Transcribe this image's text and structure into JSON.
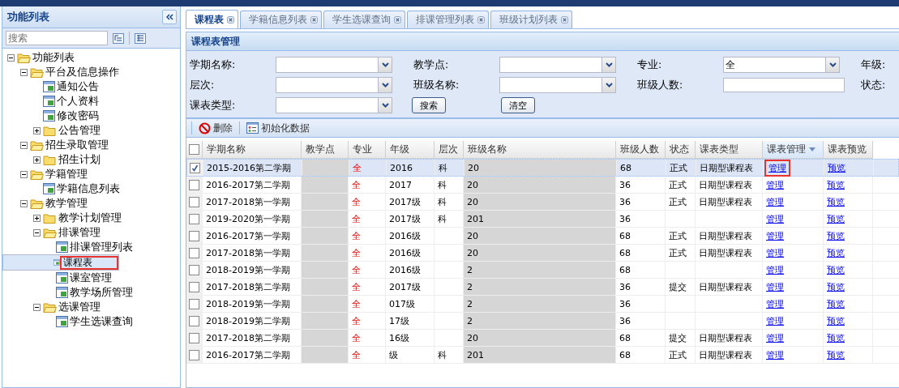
{
  "sidebar": {
    "title": "功能列表",
    "search": {
      "placeholder": "搜索"
    },
    "tree": [
      {
        "label": "功能列表",
        "kind": "folder",
        "expanded": true,
        "selected": false,
        "annotated": false,
        "children": [
          {
            "label": "平台及信息操作",
            "kind": "folder",
            "expanded": true,
            "selected": false,
            "annotated": false,
            "children": [
              {
                "label": "通知公告",
                "kind": "page",
                "selected": false,
                "annotated": false
              },
              {
                "label": "个人资料",
                "kind": "page",
                "selected": false,
                "annotated": false
              },
              {
                "label": "修改密码",
                "kind": "page",
                "selected": false,
                "annotated": false
              },
              {
                "label": "公告管理",
                "kind": "folder",
                "expanded": false,
                "selected": false,
                "annotated": false
              }
            ]
          },
          {
            "label": "招生录取管理",
            "kind": "folder",
            "expanded": true,
            "selected": false,
            "annotated": false,
            "children": [
              {
                "label": "招生计划",
                "kind": "folder",
                "expanded": false,
                "selected": false,
                "annotated": false
              }
            ]
          },
          {
            "label": "学籍管理",
            "kind": "folder",
            "expanded": true,
            "selected": false,
            "annotated": false,
            "children": [
              {
                "label": "学籍信息列表",
                "kind": "page",
                "selected": false,
                "annotated": false
              }
            ]
          },
          {
            "label": "教学管理",
            "kind": "folder",
            "expanded": true,
            "selected": false,
            "annotated": false,
            "children": [
              {
                "label": "教学计划管理",
                "kind": "folder",
                "expanded": false,
                "selected": false,
                "annotated": false
              },
              {
                "label": "排课管理",
                "kind": "folder",
                "expanded": true,
                "selected": false,
                "annotated": false,
                "children": [
                  {
                    "label": "排课管理列表",
                    "kind": "page",
                    "selected": false,
                    "annotated": false
                  },
                  {
                    "label": "课程表",
                    "kind": "page",
                    "selected": true,
                    "annotated": true
                  },
                  {
                    "label": "课室管理",
                    "kind": "page",
                    "selected": false,
                    "annotated": false
                  },
                  {
                    "label": "教学场所管理",
                    "kind": "page",
                    "selected": false,
                    "annotated": false
                  }
                ]
              },
              {
                "label": "选课管理",
                "kind": "folder",
                "expanded": true,
                "selected": false,
                "annotated": false,
                "children": [
                  {
                    "label": "学生选课查询",
                    "kind": "page",
                    "selected": false,
                    "annotated": false
                  }
                ]
              }
            ]
          }
        ]
      }
    ]
  },
  "tabs": [
    {
      "label": "课程表",
      "selected": true
    },
    {
      "label": "学籍信息列表",
      "selected": false
    },
    {
      "label": "学生选课查询",
      "selected": false
    },
    {
      "label": "排课管理列表",
      "selected": false
    },
    {
      "label": "班级计划列表",
      "selected": false
    }
  ],
  "panel": {
    "title": "课程表管理",
    "form": [
      [
        {
          "label": "学期名称:",
          "kind": "select"
        },
        {
          "label": "教学点:",
          "kind": "select"
        },
        {
          "label": "专业:",
          "kind": "select",
          "value": "全"
        },
        {
          "label": "年级:",
          "kind": "none"
        }
      ],
      [
        {
          "label": "层次:",
          "kind": "select"
        },
        {
          "label": "班级名称:",
          "kind": "select"
        },
        {
          "label": "班级人数:",
          "kind": "text"
        },
        {
          "label": "状态:",
          "kind": "none"
        }
      ],
      [
        {
          "label": "课表类型:",
          "kind": "select"
        },
        {
          "label": "搜索",
          "kind": "button"
        },
        {
          "label": "清空",
          "kind": "button"
        }
      ]
    ],
    "toolbar": [
      {
        "label": "删除",
        "kind": "delete"
      },
      {
        "label": "初始化数据",
        "kind": "init"
      }
    ],
    "table": {
      "all_checked": false,
      "columns": [
        {
          "label": "学期名称",
          "redacted": false
        },
        {
          "label": "教学点",
          "redacted": true
        },
        {
          "label": "专业",
          "redacted": false
        },
        {
          "label": "年级",
          "redacted": false
        },
        {
          "label": "层次",
          "redacted": false
        },
        {
          "label": "班级名称",
          "redacted": true
        },
        {
          "label": "班级人数",
          "redacted": false
        },
        {
          "label": "状态",
          "redacted": false
        },
        {
          "label": "课表类型",
          "redacted": false
        },
        {
          "label": "课表管理",
          "redacted": false,
          "sorted": true
        },
        {
          "label": "课表预览",
          "redacted": false
        }
      ],
      "rows": [
        {
          "selected": true,
          "cells": [
            "2015-2016第二学期",
            "",
            "全",
            "2016",
            "科",
            "20",
            "68",
            "正式",
            "日期型课程表",
            "管理",
            "预览"
          ],
          "annotated": true
        },
        {
          "selected": false,
          "cells": [
            "2016-2017第二学期",
            "",
            "全",
            "2017",
            "科",
            "20",
            "36",
            "正式",
            "日期型课程表",
            "管理",
            "预览"
          ],
          "annotated": false
        },
        {
          "selected": false,
          "cells": [
            "2017-2018第一学期",
            "",
            "全",
            "2017级",
            "科",
            "20",
            "36",
            "正式",
            "日期型课程表",
            "管理",
            "预览"
          ],
          "annotated": false
        },
        {
          "selected": false,
          "cells": [
            "2019-2020第一学期",
            "",
            "全",
            "2017级",
            "科",
            "201",
            "36",
            "",
            "",
            "管理",
            "预览"
          ],
          "annotated": false
        },
        {
          "selected": false,
          "cells": [
            "2016-2017第一学期",
            "",
            "全",
            "2016级",
            "",
            "20",
            "68",
            "正式",
            "日期型课程表",
            "管理",
            "预览"
          ],
          "annotated": false
        },
        {
          "selected": false,
          "cells": [
            "2017-2018第一学期",
            "",
            "全",
            "2016级",
            "",
            "20",
            "68",
            "正式",
            "日期型课程表",
            "管理",
            "预览"
          ],
          "annotated": false
        },
        {
          "selected": false,
          "cells": [
            "2018-2019第一学期",
            "",
            "全",
            "2016级",
            "",
            "2",
            "68",
            "",
            "",
            "管理",
            "预览"
          ],
          "annotated": false
        },
        {
          "selected": false,
          "cells": [
            "2017-2018第二学期",
            "",
            "全",
            "2017级",
            "",
            "2",
            "36",
            "提交",
            "日期型课程表",
            "管理",
            "预览"
          ],
          "annotated": false
        },
        {
          "selected": false,
          "cells": [
            "2018-2019第一学期",
            "",
            "全",
            "017级",
            "",
            "2",
            "36",
            "",
            "",
            "管理",
            "预览"
          ],
          "annotated": false
        },
        {
          "selected": false,
          "cells": [
            "2018-2019第二学期",
            "",
            "全",
            "17级",
            "",
            "2",
            "36",
            "",
            "",
            "管理",
            "预览"
          ],
          "annotated": false
        },
        {
          "selected": false,
          "cells": [
            "2017-2018第二学期",
            "",
            "全",
            "16级",
            "",
            "20",
            "68",
            "提交",
            "日期型课程表",
            "管理",
            "预览"
          ],
          "annotated": false
        },
        {
          "selected": false,
          "cells": [
            "2016-2017第二学期",
            "",
            "全",
            "级",
            "科",
            "201",
            "68",
            "正式",
            "日期型课程表",
            "管理",
            "预览"
          ],
          "annotated": false
        }
      ]
    }
  }
}
